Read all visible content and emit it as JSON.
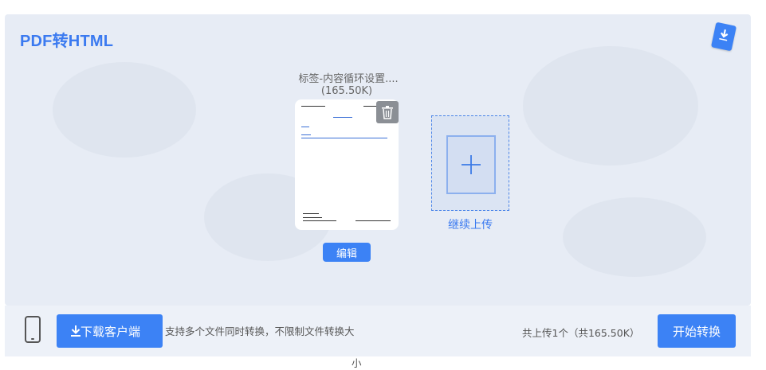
{
  "app": {
    "title": "PDF转HTML",
    "accent": "#3c82f5"
  },
  "file": {
    "name": "标签-内容循环设置....",
    "size": "(165.50K)",
    "edit_label": "编辑"
  },
  "upload": {
    "continue_label": "继续上传"
  },
  "footer": {
    "download_label": "下载客户端",
    "support_text_1": "支持多个文件同时转换，不限制文件转换大",
    "support_text_2": "小",
    "total_text": "共上传1个（共165.50K）",
    "start_label": "开始转换"
  },
  "icons": {
    "badge": "download-badge-icon",
    "trash": "trash-icon",
    "plus": "plus-icon",
    "phone": "phone-icon",
    "download": "download-arrow-icon"
  }
}
